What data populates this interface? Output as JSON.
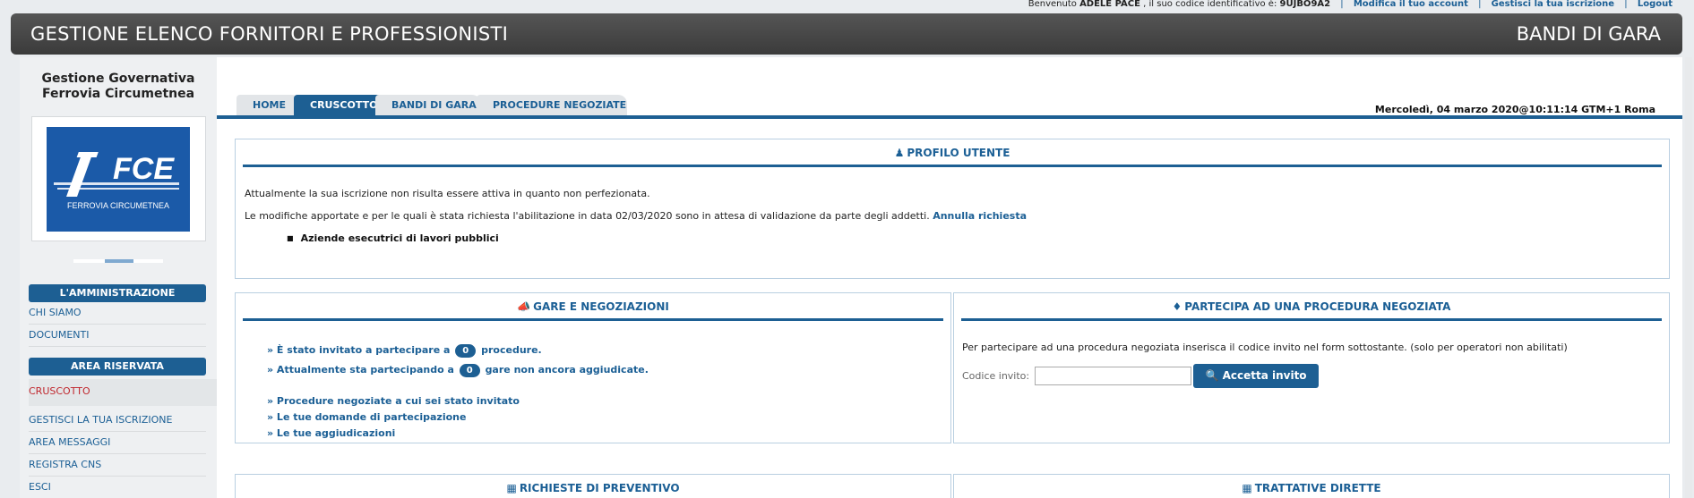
{
  "userbar": {
    "welcome_prefix": "Benvenuto",
    "user_name": "ADELE PACE",
    "code_text": ", il suo codice identificativo è:",
    "code": "9UJBO9A2",
    "modify_account": "Modifica il tuo account",
    "manage_registration": "Gestisci la tua iscrizione",
    "logout": "Logout"
  },
  "header": {
    "app_title": "GESTIONE ELENCO FORNITORI E PROFESSIONISTI",
    "section_title": "BANDI DI GARA"
  },
  "sidebar": {
    "org_line1": "Gestione Governativa",
    "org_line2": "Ferrovia Circumetnea",
    "logo_text": "FCE",
    "logo_caption": "FERROVIA CIRCUMETNEA",
    "admin_head": "L'AMMINISTRAZIONE",
    "admin_items": [
      "CHI SIAMO",
      "DOCUMENTI"
    ],
    "reserved_head": "AREA RISERVATA",
    "active_item": "CRUSCOTTO",
    "reserved_items": [
      "GESTISCI LA TUA ISCRIZIONE",
      "AREA MESSAGGI",
      "REGISTRA CNS",
      "ESCI"
    ]
  },
  "tabs": [
    "HOME",
    "CRUSCOTTO",
    "BANDI DI GARA",
    "PROCEDURE NEGOZIATE"
  ],
  "active_tab": "CRUSCOTTO",
  "datetime": "Mercoledì, 04 marzo 2020@10:11:14 GTM+1 Roma",
  "profile": {
    "title": "PROFILO UTENTE",
    "line1": "Attualmente la sua iscrizione non risulta essere attiva in quanto non perfezionata.",
    "line2": "Le modifiche apportate e per le quali è stata richiesta l'abilitazione in data 02/03/2020 sono in attesa di validazione da parte degli addetti.",
    "cancel_link": "Annulla richiesta",
    "bullet": "Aziende esecutrici di lavori pubblici"
  },
  "gare": {
    "title": "GARE E NEGOZIAZIONI",
    "invited_pre": "» È stato invitato a partecipare a",
    "invited_count": "0",
    "invited_post": "procedure.",
    "participating_pre": "» Attualmente sta partecipando a",
    "participating_count": "0",
    "participating_post": "gare non ancora aggiudicate.",
    "link1": "» Procedure negoziate a cui sei stato invitato",
    "link2": "» Le tue domande di partecipazione",
    "link3": "» Le tue aggiudicazioni"
  },
  "partecipa": {
    "title": "PARTECIPA AD UNA PROCEDURA NEGOZIATA",
    "description": "Per partecipare ad una procedura negoziata inserisca il codice invito nel form sottostante. (solo per operatori non abilitati)",
    "code_label": "Codice invito:",
    "code_value": "",
    "button": "Accetta invito"
  },
  "bottom_panels": {
    "left_title": "RICHIESTE DI PREVENTIVO",
    "right_title": "TRATTATIVE DIRETTE"
  },
  "colors": {
    "accent": "#1d5f93",
    "link": "#1b5f95",
    "active_menu": "#c0272d",
    "header_bg": "#444444"
  }
}
